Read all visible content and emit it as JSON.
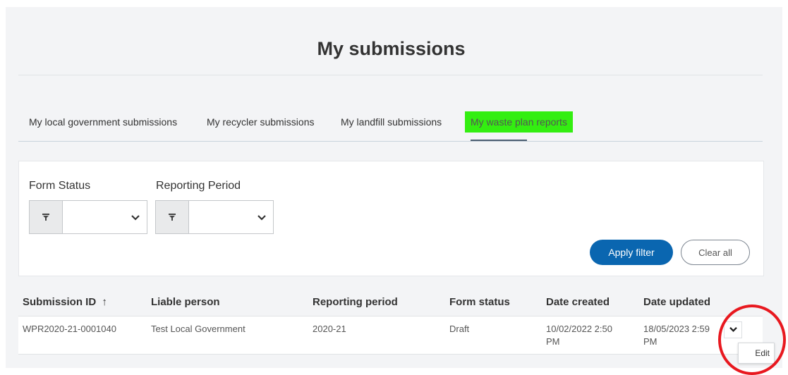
{
  "page": {
    "title": "My submissions"
  },
  "tabs": [
    {
      "label": "My local government submissions"
    },
    {
      "label": "My recycler submissions"
    },
    {
      "label": "My landfill submissions"
    },
    {
      "label": "My waste plan reports",
      "active": true,
      "highlight_color": "#33ee11"
    }
  ],
  "filters": {
    "form_status": {
      "label": "Form Status",
      "value": ""
    },
    "reporting_period": {
      "label": "Reporting Period",
      "value": ""
    },
    "apply_label": "Apply filter",
    "clear_label": "Clear all"
  },
  "table": {
    "columns": [
      "Submission ID",
      "Liable person",
      "Reporting period",
      "Form status",
      "Date created",
      "Date updated"
    ],
    "sort_indicator": "↑",
    "rows": [
      {
        "submission_id": "WPR2020-21-0001040",
        "liable_person": "Test Local Government",
        "reporting_period": "2020-21",
        "form_status": "Draft",
        "date_created_line1": "10/02/2022 2:50",
        "date_created_line2": "PM",
        "date_updated_line1": "18/05/2023 2:59",
        "date_updated_line2": "PM"
      }
    ]
  },
  "row_menu": {
    "edit_label": "Edit"
  },
  "icons": {
    "filter": "filter-icon",
    "chevron": "chevron-down-icon",
    "annotation": "red-circle-annotation"
  },
  "colors": {
    "accent": "#0a66b0",
    "highlight": "#33ee11",
    "annotation": "#e8181f"
  }
}
